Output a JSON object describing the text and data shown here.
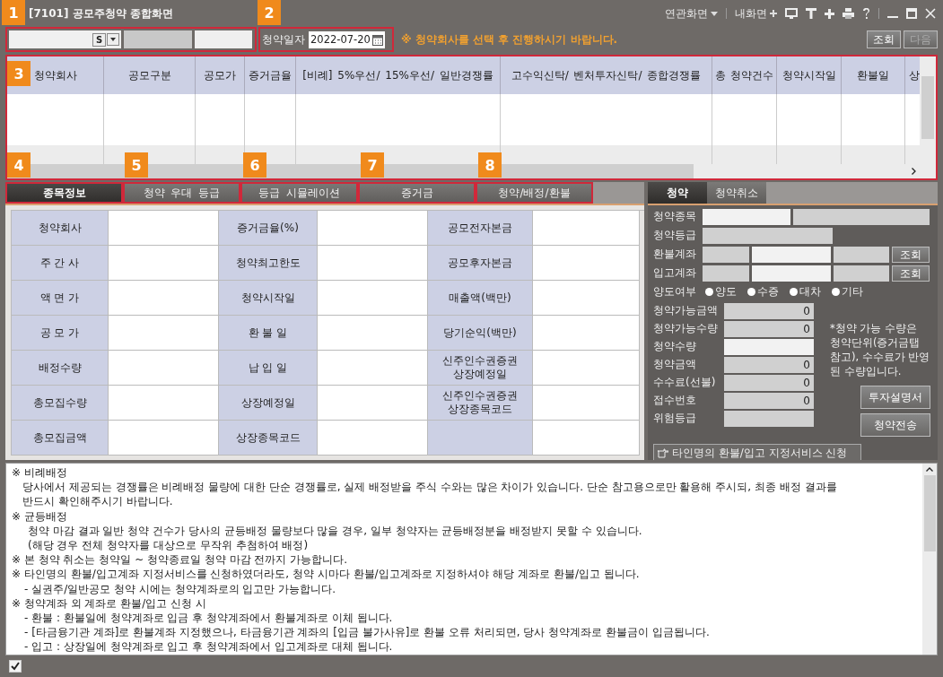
{
  "window": {
    "title": "[7101] 공모주청약 종합화면",
    "menus": [
      "연관화면",
      "내화면"
    ]
  },
  "search": {
    "code_button": "S",
    "date_label": "청약일자",
    "date": "2022-07-20",
    "notice": "※ 청약회사를 선택 후 진행하시기 바랍니다.",
    "buttons": [
      {
        "label": "조회",
        "disabled": false
      },
      {
        "label": "다음",
        "disabled": true
      }
    ]
  },
  "table": {
    "columns": [
      "청약회사",
      "공모구분",
      "공모가",
      "증거금율",
      "[비례]  5%우선/   15%우선/   일반경쟁률",
      "고수익신탁/  벤처투자신탁/  종합경쟁률",
      "총 청약건수",
      "청약시작일",
      "환불일",
      "상"
    ]
  },
  "tabs": [
    {
      "label": "종목정보",
      "selected": true
    },
    {
      "label": "청약 우대 등급",
      "selected": false
    },
    {
      "label": "등급 시뮬레이션",
      "selected": false
    },
    {
      "label": "증거금",
      "selected": false
    },
    {
      "label": "청약/배정/환불",
      "selected": false
    }
  ],
  "info_grid": [
    [
      "청약회사",
      "증거금율(%)",
      "공모전자본금"
    ],
    [
      "주 간 사",
      "청약최고한도",
      "공모후자본금"
    ],
    [
      "액 면 가",
      "청약시작일",
      "매출액(백만)"
    ],
    [
      "공 모 가",
      "환 불 일",
      "당기순익(백만)"
    ],
    [
      "배정수량",
      "납 입 일",
      "신주인수권증권\n상장예정일"
    ],
    [
      "총모집수량",
      "상장예정일",
      "신주인수권증권\n상장종목코드"
    ],
    [
      "총모집금액",
      "상장종목코드"
    ]
  ],
  "order_tabs": [
    {
      "label": "청약",
      "selected": true
    },
    {
      "label": "청약취소",
      "selected": false
    }
  ],
  "order_form": {
    "rows": [
      {
        "kind": "pair",
        "label": "청약종목"
      },
      {
        "kind": "single",
        "label": "청약등급"
      },
      {
        "kind": "account",
        "label": "환불계좌",
        "button": "조회"
      },
      {
        "kind": "account",
        "label": "입고계좌",
        "button": "조회"
      }
    ],
    "transfer": {
      "label": "양도여부",
      "options": [
        "양도",
        "수증",
        "대차",
        "기타"
      ]
    },
    "amounts": [
      {
        "label": "청약가능금액",
        "value": "0",
        "editable": false
      },
      {
        "label": "청약가능수량",
        "value": "0",
        "editable": false
      },
      {
        "label": "청약수량",
        "editable": true
      },
      {
        "label": "청약금액",
        "value": "0",
        "editable": false
      },
      {
        "label": "수수료(선불)",
        "value": "0",
        "editable": false
      },
      {
        "label": "접수번호",
        "value": "0",
        "editable": false
      },
      {
        "label": "위험등급",
        "editable": false
      }
    ],
    "note": "*청약 가능 수량은 청약단위(증거금탭 참고), 수수료가 반영된 수량입니다.",
    "buttons": [
      "투자설명서",
      "청약전송"
    ],
    "service_button": "타인명의 환불/입고 지정서비스 신청"
  },
  "notes": [
    {
      "kind": "mark",
      "text": "※ 비례배정"
    },
    {
      "kind": "body",
      "text": "당사에서 제공되는 경쟁률은 비례배정 물량에 대한 단순 경쟁률로, 실제 배정받을 주식 수와는 많은 차이가 있습니다. 단순 참고용으로만 활용해 주시되, 최종 배정 결과를"
    },
    {
      "kind": "body",
      "text": "반드시 확인해주시기 바랍니다."
    },
    {
      "kind": "mark",
      "text": "※ 균등배정"
    },
    {
      "kind": "body2",
      "text": "청약 마감 결과 일반 청약 건수가 당사의 균등배정 물량보다 많을 경우, 일부 청약자는 균등배정분을 배정받지 못할 수 있습니다."
    },
    {
      "kind": "body2",
      "text": "(해당 경우 전체 청약자를 대상으로 무작위 추첨하여 배정)"
    },
    {
      "kind": "mark",
      "text": "※ 본 청약 취소는 청약일 ~ 청약종료일 청약 마감 전까지 가능합니다."
    },
    {
      "kind": "mark",
      "text": "※ 타인명의 환불/입고계좌 지정서비스를 신청하였더라도, 청약 시마다 환불/입고계좌로 지정하셔야 해당 계좌로 환불/입고 됩니다."
    },
    {
      "kind": "dash",
      "text": "- 실권주/일반공모 청약 시에는 청약계좌로의 입고만 가능합니다."
    },
    {
      "kind": "mark",
      "text": "※ 청약계좌 외 계좌로 환불/입고 신청 시"
    },
    {
      "kind": "dash",
      "text": "- 환불 : 환불일에 청약계좌로 입금 후 청약계좌에서 환불계좌로 이체 됩니다."
    },
    {
      "kind": "dash",
      "text": "- [타금융기관 계좌]로 환불계좌 지정했으나, 타금융기관 계좌의 [입금 불가사유]로 환불 오류 처리되면, 당사 청약계좌로 환불금이 입금됩니다."
    },
    {
      "kind": "dash",
      "text": "- 입고 : 상장일에 청약계좌로 입고 후 청약계좌에서 입고계좌로 대체 됩니다."
    }
  ],
  "status_bar": {
    "checked": true
  },
  "callouts": [
    "1",
    "2",
    "3",
    "4",
    "5",
    "6",
    "7",
    "8"
  ]
}
